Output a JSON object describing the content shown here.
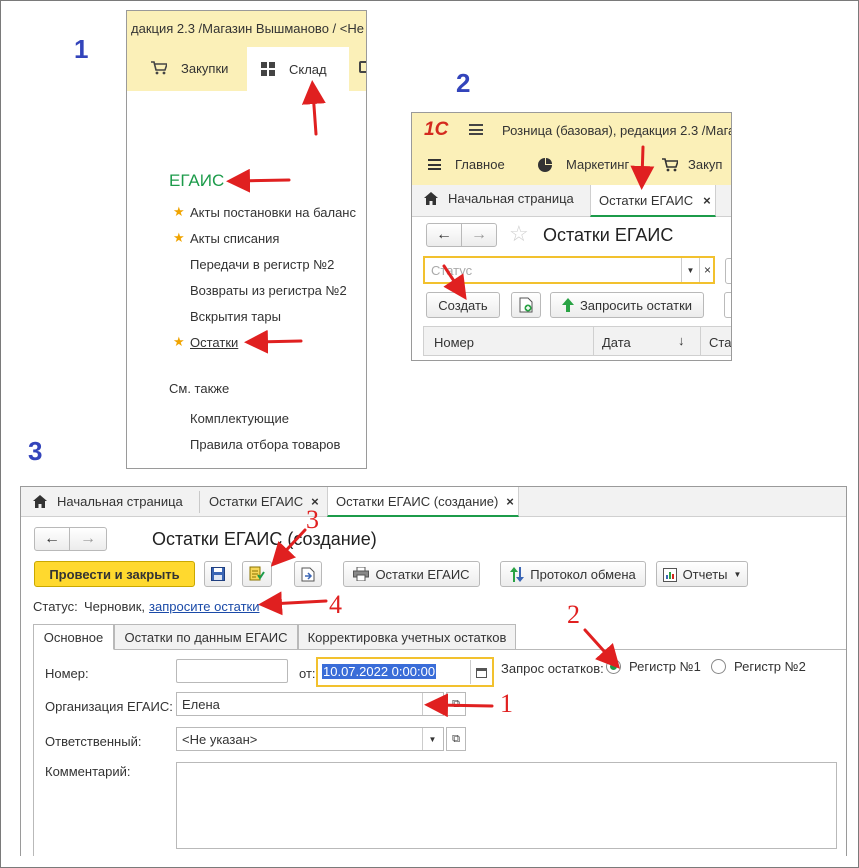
{
  "steps": {
    "s1": "1",
    "s2": "2",
    "s3": "3"
  },
  "annotations": {
    "a1": "1",
    "a2": "2",
    "a3": "3",
    "a4": "4"
  },
  "panel1": {
    "title_bar": "дакция 2.3 /Магазин Вышманово / <Не",
    "tabs": [
      {
        "label": "Закупки"
      },
      {
        "label": "Склад"
      }
    ],
    "section_title": "ЕГАИС",
    "items": [
      {
        "label": "Акты постановки на баланс",
        "starred": true
      },
      {
        "label": "Акты списания",
        "starred": true
      },
      {
        "label": "Передачи в регистр №2",
        "starred": false
      },
      {
        "label": "Возвраты из регистра №2",
        "starred": false
      },
      {
        "label": "Вскрытия тары",
        "starred": false
      },
      {
        "label": "Остатки",
        "starred": true
      }
    ],
    "see_also_title": "См. также",
    "see_also": [
      {
        "label": "Комплектующие"
      },
      {
        "label": "Правила отбора товаров"
      }
    ]
  },
  "panel2": {
    "logo": "1С",
    "title_bar": "Розница (базовая), редакция 2.3 /Магази",
    "menu": [
      {
        "label": "Главное"
      },
      {
        "label": "Маркетинг"
      },
      {
        "label": "Закуп"
      }
    ],
    "tabs": [
      {
        "label": "Начальная страница"
      },
      {
        "label": "Остатки ЕГАИС"
      }
    ],
    "close_glyph": "×",
    "page_title": "Остатки ЕГАИС",
    "status_placeholder": "Статус",
    "create_label": "Создать",
    "request_label": "Запросить остатки",
    "columns": [
      {
        "label": "Номер"
      },
      {
        "label": "Дата"
      },
      {
        "label": "Ста"
      }
    ]
  },
  "panel3": {
    "tabs": [
      {
        "label": "Начальная страница"
      },
      {
        "label": "Остатки ЕГАИС"
      },
      {
        "label": "Остатки ЕГАИС (создание)"
      }
    ],
    "close_glyph": "×",
    "page_title": "Остатки ЕГАИС (создание)",
    "post_close_label": "Провести и закрыть",
    "remains_btn_label": "Остатки ЕГАИС",
    "protocol_label": "Протокол обмена",
    "reports_label": "Отчеты",
    "status_label": "Статус:",
    "status_value": "Черновик,",
    "status_link": "запросите остатки",
    "sections": [
      {
        "label": "Основное"
      },
      {
        "label": "Остатки по данным ЕГАИС"
      },
      {
        "label": "Корректировка учетных остатков"
      }
    ],
    "number_label": "Номер:",
    "number_value": "",
    "from_label": "от:",
    "date_value": "10.07.2022  0:00:00",
    "request_label": "Запрос остатков:",
    "radio": [
      {
        "label": "Регистр №1",
        "checked": true
      },
      {
        "label": "Регистр №2",
        "checked": false
      }
    ],
    "org_label": "Организация ЕГАИС:",
    "org_value": "Елена",
    "resp_label": "Ответственный:",
    "resp_value": "<Не указан>",
    "comment_label": "Комментарий:",
    "comment_value": ""
  },
  "colors": {
    "accent_green": "#1c9b4a",
    "arrow_red": "#e02020",
    "step_blue": "#3344bb",
    "button_yellow": "#ffd92e",
    "highlight_yellow": "#f2c12e"
  }
}
